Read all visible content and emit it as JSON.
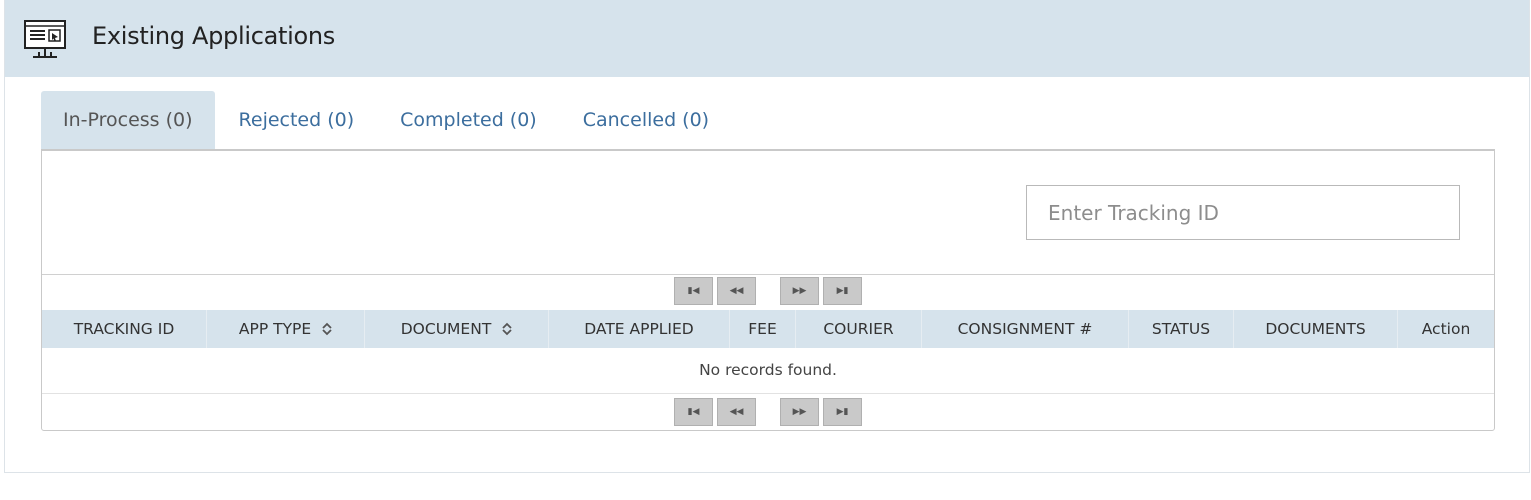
{
  "header": {
    "title": "Existing Applications",
    "icon": "monitor-application-icon"
  },
  "tabs": [
    {
      "label": "In-Process (0)",
      "active": true
    },
    {
      "label": "Rejected (0)",
      "active": false
    },
    {
      "label": "Completed (0)",
      "active": false
    },
    {
      "label": "Cancelled (0)",
      "active": false
    }
  ],
  "search": {
    "placeholder": "Enter Tracking ID",
    "value": ""
  },
  "paginator": {
    "first_icon": "first-page-icon",
    "prev_icon": "previous-page-icon",
    "next_icon": "next-page-icon",
    "last_icon": "last-page-icon"
  },
  "table": {
    "columns": [
      {
        "label": "TRACKING ID",
        "sortable": false
      },
      {
        "label": "APP TYPE",
        "sortable": true
      },
      {
        "label": "DOCUMENT",
        "sortable": true
      },
      {
        "label": "DATE APPLIED",
        "sortable": false
      },
      {
        "label": "FEE",
        "sortable": false
      },
      {
        "label": "COURIER",
        "sortable": false
      },
      {
        "label": "CONSIGNMENT #",
        "sortable": false
      },
      {
        "label": "STATUS",
        "sortable": false
      },
      {
        "label": "DOCUMENTS",
        "sortable": false
      },
      {
        "label": "Action",
        "sortable": false
      }
    ],
    "empty_message": "No records found."
  },
  "colors": {
    "header_bg": "#d6e3ec",
    "tab_link": "#3c6e9e",
    "paginator_button": "#c9c9c9"
  }
}
